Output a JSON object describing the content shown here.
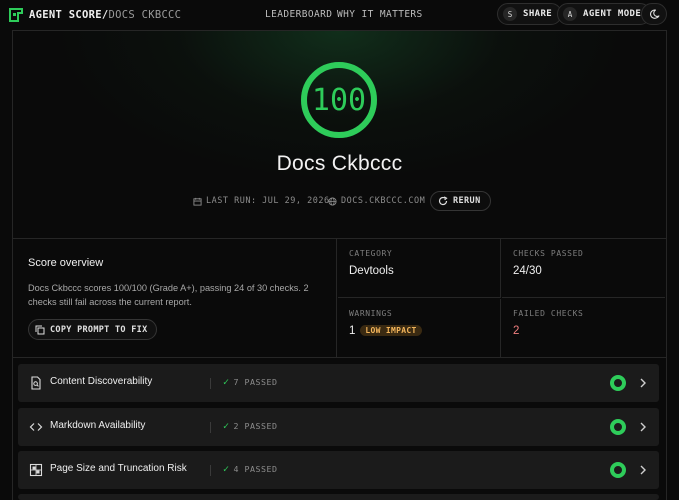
{
  "nav": {
    "brand_main": "AGENT SCORE",
    "brand_sep": "/",
    "brand_sub": "DOCS CKBCCC",
    "links": [
      "LEADERBOARD",
      "WHY IT MATTERS"
    ],
    "share": {
      "key": "S",
      "label": "SHARE"
    },
    "agent_mode": {
      "key": "A",
      "label": "AGENT MODE"
    },
    "theme_icon": "moon-icon"
  },
  "hero": {
    "score": "100",
    "score_fraction": 1.0,
    "title": "Docs Ckbccc",
    "last_run": "LAST RUN: JUL 29, 2026",
    "domain": "DOCS.CKBCCC.COM",
    "rerun": "RERUN"
  },
  "overview": {
    "title": "Score overview",
    "description": "Docs Ckbccc scores 100/100 (Grade A+), passing 24 of 30 checks. 2 checks still fail across the current report.",
    "copy_prompt": "COPY PROMPT TO FIX",
    "category_label": "CATEGORY",
    "category_value": "Devtools",
    "checks_label": "CHECKS PASSED",
    "checks_value": "24/30",
    "warnings_label": "WARNINGS",
    "warnings_value": "1",
    "warnings_badge": "LOW IMPACT",
    "failed_label": "FAILED CHECKS",
    "failed_value": "2"
  },
  "categories": [
    {
      "name": "Content Discoverability",
      "passed": "7 PASSED",
      "icon": "document-search-icon"
    },
    {
      "name": "Markdown Availability",
      "passed": "2 PASSED",
      "icon": "code-brackets-icon"
    },
    {
      "name": "Page Size and Truncation Risk",
      "passed": "4 PASSED",
      "icon": "grid-icon"
    }
  ],
  "colors": {
    "accent": "#2ecc5a",
    "background": "#0a0a0a",
    "row_bg": "#1b1b1b",
    "failed": "#f07f7f",
    "warning": "#f2b45a"
  }
}
